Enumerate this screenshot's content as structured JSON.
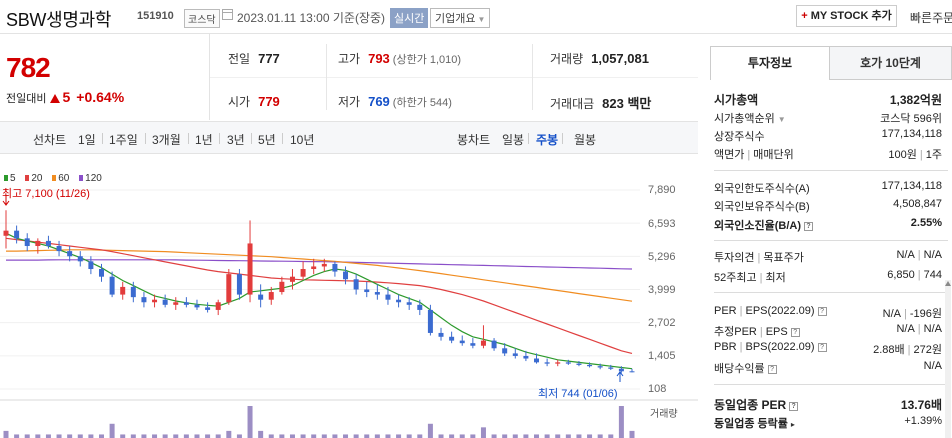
{
  "header": {
    "stock_name": "SBW생명과학",
    "stock_code": "151910",
    "market_badge": "코스닥",
    "datetime": "2023.01.11 13:00 기준(장중)",
    "realtime_badge": "실시간",
    "company_info_label": "기업개요",
    "mystock_label": "MY STOCK 추가",
    "quick_order": "빠른주문"
  },
  "quote": {
    "current_price": "782",
    "vs_prev_label": "전일대비",
    "change": "5",
    "change_pct": "+0.64%",
    "prev_close_label": "전일",
    "prev_close": "777",
    "high_label": "고가",
    "high": "793",
    "upper_limit": "(상한가 1,010)",
    "volume_label": "거래량",
    "volume": "1,057,081",
    "open_label": "시가",
    "open": "779",
    "low_label": "저가",
    "low": "769",
    "lower_limit": "(하한가 544)",
    "trade_value_label": "거래대금",
    "trade_value": "823 백만"
  },
  "period_bar": {
    "line_chart_label": "선차트",
    "line_periods": [
      "1일",
      "1주일",
      "3개월",
      "1년",
      "3년",
      "5년",
      "10년"
    ],
    "candle_chart_label": "봉차트",
    "candle_periods": [
      "일봉",
      "주봉",
      "월봉"
    ],
    "active_candle": "주봉"
  },
  "chart_data": {
    "type": "candlestick",
    "period": "weekly",
    "ylim": [
      108,
      7890
    ],
    "y_ticks": [
      "7,890",
      "6,593",
      "5,296",
      "3,999",
      "2,702",
      "1,405",
      "108"
    ],
    "ma_legend": [
      {
        "name": "5",
        "color": "#2c9a2c"
      },
      {
        "name": "20",
        "color": "#e04040"
      },
      {
        "name": "60",
        "color": "#f08c20"
      },
      {
        "name": "120",
        "color": "#8a4fc9"
      }
    ],
    "high_annotation": "최고 7,100 (11/26)",
    "low_annotation": "최저 744 (01/06)",
    "volume_label": "거래량",
    "up_color": "#e23c3c",
    "down_color": "#3b6bd0",
    "candles": [
      [
        6100,
        7100,
        5600,
        6300
      ],
      [
        6300,
        6500,
        5800,
        6000
      ],
      [
        6000,
        6200,
        5500,
        5700
      ],
      [
        5700,
        6000,
        5400,
        5900
      ],
      [
        5900,
        6100,
        5600,
        5700
      ],
      [
        5700,
        5900,
        5300,
        5500
      ],
      [
        5500,
        5700,
        5100,
        5300
      ],
      [
        5300,
        5500,
        4900,
        5100
      ],
      [
        5100,
        5300,
        4600,
        4800
      ],
      [
        4800,
        5000,
        4300,
        4500
      ],
      [
        4500,
        4700,
        3700,
        3800
      ],
      [
        3800,
        4300,
        3600,
        4100
      ],
      [
        4100,
        4300,
        3500,
        3700
      ],
      [
        3700,
        3900,
        3300,
        3500
      ],
      [
        3500,
        3800,
        3300,
        3600
      ],
      [
        3600,
        3800,
        3300,
        3400
      ],
      [
        3400,
        3700,
        3200,
        3500
      ],
      [
        3500,
        3700,
        3300,
        3400
      ],
      [
        3400,
        3600,
        3200,
        3300
      ],
      [
        3300,
        3500,
        3100,
        3200
      ],
      [
        3200,
        3600,
        3000,
        3500
      ],
      [
        3500,
        4800,
        3400,
        4600
      ],
      [
        4600,
        4800,
        3600,
        3800
      ],
      [
        3800,
        6700,
        3500,
        5800
      ],
      [
        3800,
        4200,
        3300,
        3600
      ],
      [
        3600,
        4100,
        3400,
        3900
      ],
      [
        3900,
        4500,
        3800,
        4300
      ],
      [
        4300,
        4800,
        4000,
        4500
      ],
      [
        4500,
        5100,
        4400,
        4800
      ],
      [
        4800,
        5200,
        4600,
        4900
      ],
      [
        4900,
        5200,
        4700,
        5000
      ],
      [
        5000,
        5100,
        4500,
        4700
      ],
      [
        4700,
        4900,
        4200,
        4400
      ],
      [
        4400,
        4600,
        3800,
        4000
      ],
      [
        4000,
        4300,
        3700,
        3900
      ],
      [
        3900,
        4200,
        3600,
        3800
      ],
      [
        3800,
        4100,
        3400,
        3600
      ],
      [
        3600,
        3800,
        3300,
        3500
      ],
      [
        3500,
        3700,
        3200,
        3400
      ],
      [
        3400,
        3600,
        3000,
        3200
      ],
      [
        3200,
        3400,
        2200,
        2300
      ],
      [
        2300,
        2500,
        2000,
        2150
      ],
      [
        2150,
        2350,
        1900,
        2000
      ],
      [
        2000,
        2200,
        1800,
        1900
      ],
      [
        1900,
        2100,
        1700,
        1800
      ],
      [
        1800,
        2600,
        1700,
        2000
      ],
      [
        2000,
        2100,
        1600,
        1700
      ],
      [
        1700,
        1900,
        1400,
        1500
      ],
      [
        1500,
        1700,
        1300,
        1400
      ],
      [
        1400,
        1600,
        1200,
        1300
      ],
      [
        1300,
        1500,
        1100,
        1150
      ],
      [
        1150,
        1300,
        1000,
        1100
      ],
      [
        1100,
        1250,
        1000,
        1150
      ],
      [
        1150,
        1250,
        1050,
        1100
      ],
      [
        1100,
        1200,
        1000,
        1050
      ],
      [
        1050,
        1150,
        950,
        1000
      ],
      [
        1000,
        1100,
        880,
        950
      ],
      [
        950,
        1050,
        850,
        900
      ],
      [
        900,
        1000,
        744,
        800
      ],
      [
        800,
        900,
        760,
        782
      ]
    ],
    "ma5": [
      6200,
      6000,
      5900,
      5800,
      5700,
      5550,
      5400,
      5250,
      5050,
      4850,
      4600,
      4350,
      4150,
      3950,
      3750,
      3650,
      3550,
      3480,
      3420,
      3380,
      3350,
      3500,
      3650,
      3900,
      3950,
      4000,
      4050,
      4150,
      4350,
      4550,
      4700,
      4800,
      4750,
      4600,
      4400,
      4200,
      4000,
      3800,
      3650,
      3500,
      3200,
      2900,
      2600,
      2350,
      2150,
      2050,
      1950,
      1850,
      1700,
      1550,
      1450,
      1350,
      1250,
      1200,
      1150,
      1100,
      1050,
      1000,
      950,
      900
    ],
    "ma20": [
      6000,
      5950,
      5900,
      5850,
      5800,
      5750,
      5700,
      5650,
      5600,
      5550,
      5480,
      5400,
      5320,
      5240,
      5160,
      5080,
      5000,
      4920,
      4840,
      4760,
      4700,
      4650,
      4600,
      4550,
      4500,
      4450,
      4420,
      4400,
      4380,
      4370,
      4360,
      4350,
      4340,
      4330,
      4310,
      4290,
      4260,
      4230,
      4190,
      4150,
      4080,
      4000,
      3900,
      3800,
      3680,
      3550,
      3400,
      3250,
      3100,
      2950,
      2800,
      2650,
      2500,
      2350,
      2200,
      2050,
      1900,
      1750,
      1600,
      1500
    ],
    "ma60": [
      5500,
      5500,
      5510,
      5520,
      5530,
      5540,
      5550,
      5550,
      5550,
      5540,
      5530,
      5520,
      5510,
      5500,
      5490,
      5480,
      5460,
      5440,
      5420,
      5400,
      5380,
      5360,
      5340,
      5320,
      5300,
      5280,
      5250,
      5220,
      5190,
      5160,
      5130,
      5100,
      5060,
      5020,
      4980,
      4940,
      4890,
      4840,
      4790,
      4740,
      4680,
      4620,
      4560,
      4500,
      4440,
      4380,
      4320,
      4260,
      4200,
      4140,
      4080,
      4020,
      3960,
      3900,
      3840,
      3780,
      3720,
      3660,
      3600,
      3540
    ],
    "ma120": [
      5150,
      5150,
      5150,
      5150,
      5155,
      5160,
      5160,
      5160,
      5160,
      5160,
      5160,
      5160,
      5160,
      5160,
      5160,
      5160,
      5155,
      5150,
      5145,
      5140,
      5135,
      5130,
      5125,
      5120,
      5115,
      5110,
      5105,
      5100,
      5095,
      5090,
      5085,
      5080,
      5070,
      5060,
      5050,
      5040,
      5030,
      5020,
      5010,
      5000,
      4990,
      4980,
      4970,
      4960,
      4950,
      4940,
      4930,
      4920,
      4910,
      4900,
      4890,
      4880,
      4870,
      4860,
      4850,
      4840,
      4830,
      4820,
      4810,
      4800
    ],
    "volume": [
      2,
      1,
      1,
      1,
      1,
      1,
      1,
      1,
      1,
      1,
      4,
      1,
      1,
      1,
      1,
      1,
      1,
      1,
      1,
      1,
      1,
      2,
      1,
      9,
      2,
      1,
      1,
      1,
      1,
      1,
      1,
      1,
      1,
      1,
      1,
      1,
      1,
      1,
      1,
      1,
      4,
      1,
      1,
      1,
      1,
      3,
      1,
      1,
      1,
      1,
      1,
      1,
      1,
      1,
      1,
      1,
      1,
      1,
      9,
      2
    ]
  },
  "right_panel": {
    "tabs": [
      "투자정보",
      "호가 10단계"
    ],
    "market_cap_label": "시가총액",
    "market_cap": "1,382억원",
    "market_cap_rank_label": "시가총액순위",
    "market_cap_rank": "코스닥 596위",
    "listed_shares_label": "상장주식수",
    "listed_shares": "177,134,118",
    "par_label": "액면가",
    "trade_unit_label": "매매단위",
    "par_value": "100원",
    "trade_unit": "1주",
    "foreign_limit_label": "외국인한도주식수(A)",
    "foreign_limit": "177,134,118",
    "foreign_hold_label": "외국인보유주식수(B)",
    "foreign_hold": "4,508,847",
    "foreign_ratio_label": "외국인소진율(B/A)",
    "foreign_ratio": "2.55%",
    "opinion_label": "투자의견",
    "target_label": "목표주가",
    "opinion": "N/A",
    "target": "N/A",
    "w52_high_label": "52주최고",
    "w52_low_label": "최저",
    "w52_high": "6,850",
    "w52_low": "744",
    "per_label": "PER",
    "eps_label": "EPS(2022.09)",
    "per": "N/A",
    "eps": "-196원",
    "est_per_label": "추정PER",
    "est_eps_label": "EPS",
    "est_per": "N/A",
    "est_eps": "N/A",
    "pbr_label": "PBR",
    "bps_label": "BPS(2022.09)",
    "pbr": "2.88배",
    "bps": "272원",
    "dividend_label": "배당수익률",
    "dividend": "N/A",
    "industry_per_label": "동일업종 PER",
    "industry_per": "13.76배",
    "industry_change_label": "동일업종 등락률",
    "industry_change": "+1.39%"
  }
}
